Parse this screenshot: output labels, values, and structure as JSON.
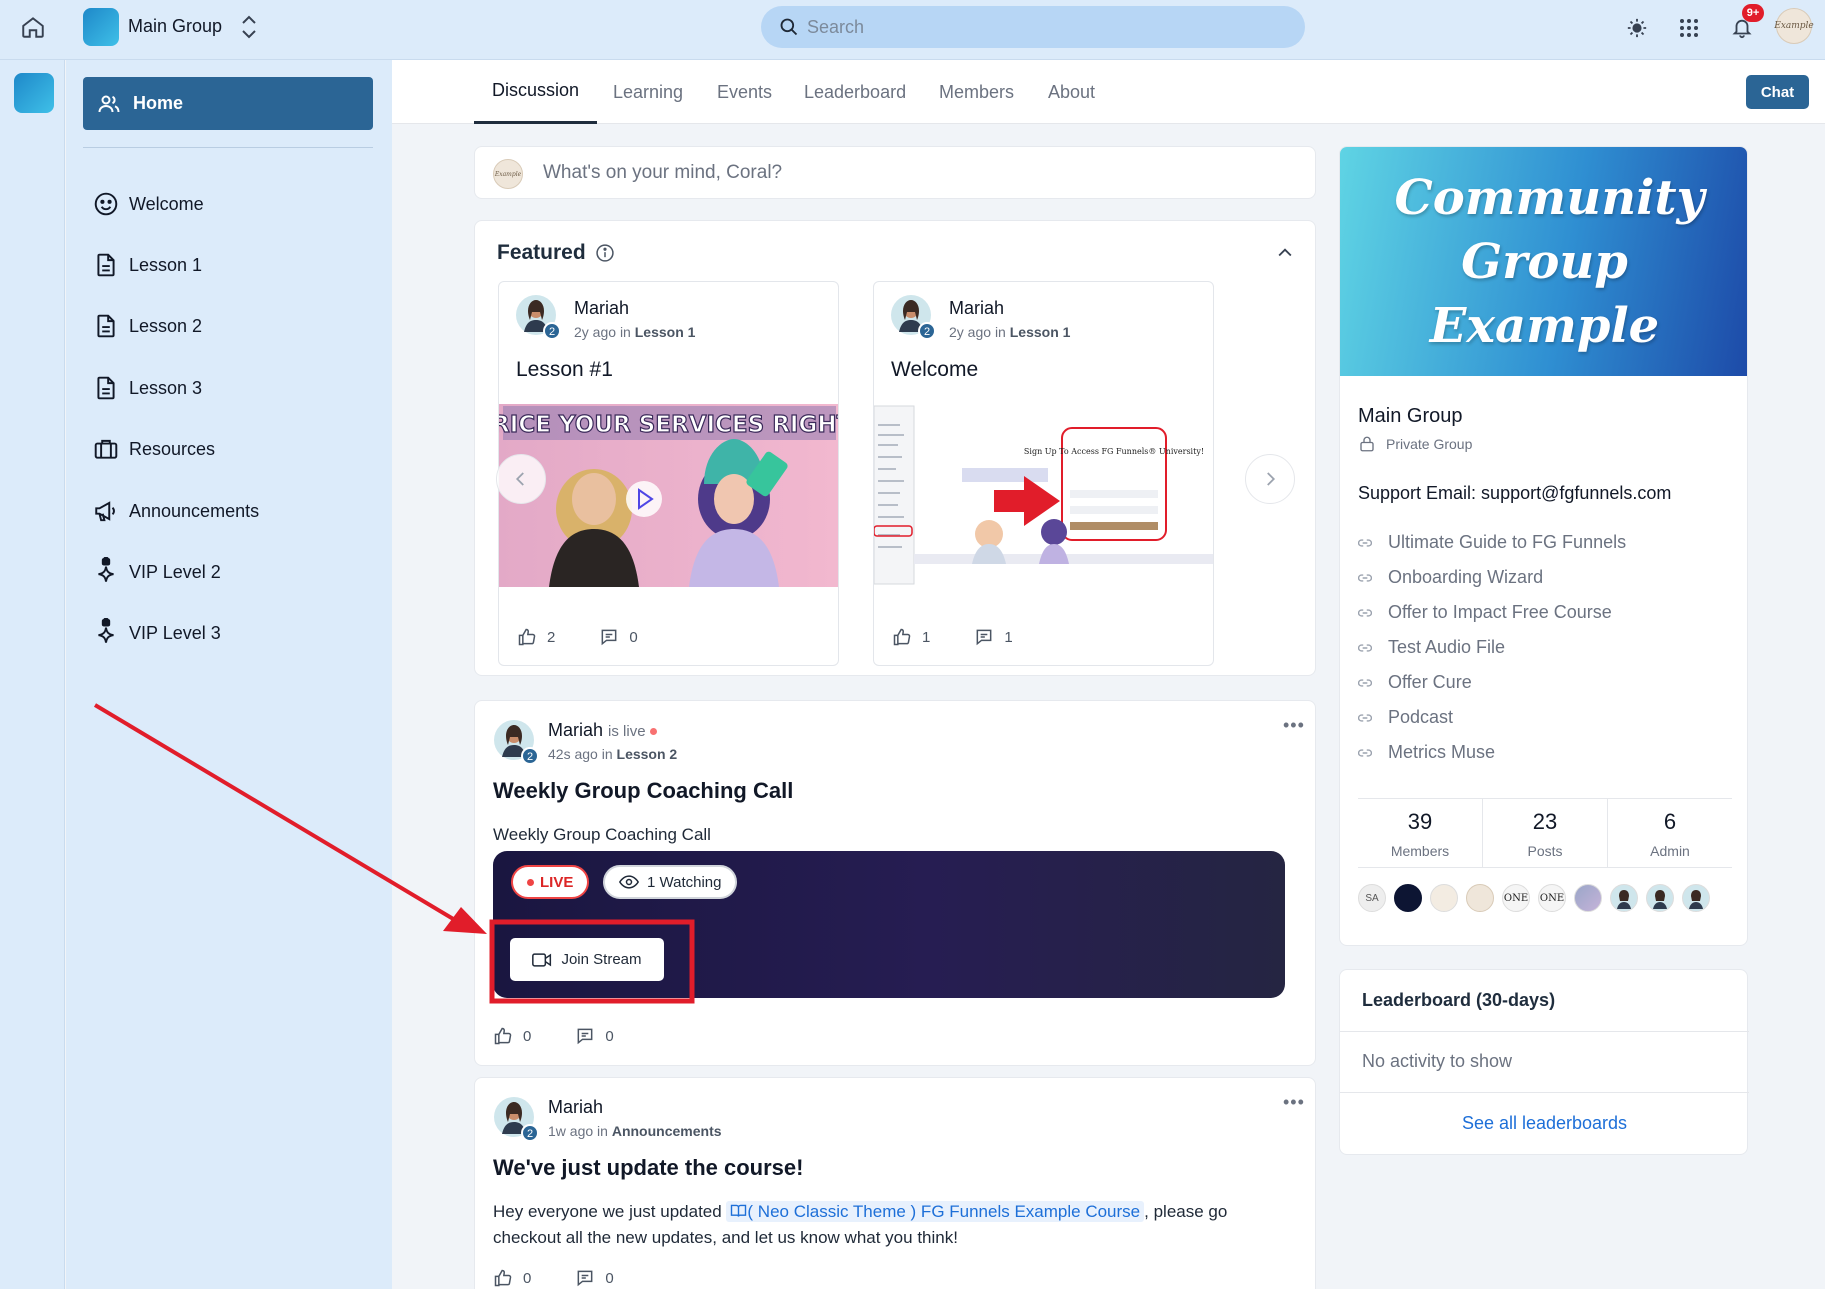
{
  "topbar": {
    "group_name": "Main Group",
    "search_placeholder": "Search",
    "notification_count": "9+",
    "avatar_text": "Example"
  },
  "sidebar": {
    "home_label": "Home",
    "items": [
      {
        "label": "Welcome",
        "icon": "smile-icon"
      },
      {
        "label": "Lesson 1",
        "icon": "document-icon"
      },
      {
        "label": "Lesson 2",
        "icon": "document-icon"
      },
      {
        "label": "Lesson 3",
        "icon": "document-icon"
      },
      {
        "label": "Resources",
        "icon": "briefcase-icon"
      },
      {
        "label": "Announcements",
        "icon": "megaphone-icon"
      },
      {
        "label": "VIP Level 2",
        "icon": "sparkle-lock-icon"
      },
      {
        "label": "VIP Level 3",
        "icon": "sparkle-lock-icon"
      }
    ]
  },
  "tabs": [
    {
      "label": "Discussion",
      "active": true
    },
    {
      "label": "Learning"
    },
    {
      "label": "Events"
    },
    {
      "label": "Leaderboard"
    },
    {
      "label": "Members"
    },
    {
      "label": "About"
    }
  ],
  "chat_label": "Chat",
  "composer": {
    "placeholder": "What's on your mind, Coral?",
    "avatar_text": "Example"
  },
  "featured": {
    "title": "Featured",
    "cards": [
      {
        "author": "Mariah",
        "badge": "2",
        "time": "2y ago",
        "in_word": "in",
        "space": "Lesson 1",
        "title": "Lesson #1",
        "thumb_text": "PRICE YOUR SERVICES RIGHT!",
        "likes": "2",
        "comments": "0"
      },
      {
        "author": "Mariah",
        "badge": "2",
        "time": "2y ago",
        "in_word": "in",
        "space": "Lesson 1",
        "title": "Welcome",
        "thumb_text": "Sign Up To Access FG Funnels® University!",
        "likes": "1",
        "comments": "1"
      }
    ]
  },
  "posts": [
    {
      "author": "Mariah",
      "badge": "2",
      "status": "is live",
      "time": "42s ago",
      "in_word": "in",
      "space": "Lesson 2",
      "title": "Weekly Group Coaching Call",
      "body": "Weekly Group Coaching Call",
      "live_label": "LIVE",
      "watching_label": "1 Watching",
      "join_label": "Join Stream",
      "likes": "0",
      "comments": "0"
    },
    {
      "author": "Mariah",
      "badge": "2",
      "time": "1w ago",
      "in_word": "in",
      "space": "Announcements",
      "title": "We've just update the course!",
      "body_before": "Hey everyone we just updated ",
      "body_link": "( Neo Classic Theme ) FG Funnels Example Course",
      "body_after": ", please go checkout all the new updates, and let us know what you think!",
      "likes": "0",
      "comments": "0"
    }
  ],
  "about": {
    "banner_text": "Community Group Example",
    "group_name": "Main Group",
    "privacy": "Private Group",
    "support": "Support Email: support@fgfunnels.com",
    "links": [
      "Ultimate Guide to FG Funnels",
      "Onboarding Wizard",
      "Offer to Impact Free Course",
      "Test Audio File",
      "Offer Cure",
      "Podcast",
      "Metrics Muse"
    ],
    "stats": [
      {
        "num": "39",
        "label": "Members"
      },
      {
        "num": "23",
        "label": "Posts"
      },
      {
        "num": "6",
        "label": "Admin"
      }
    ],
    "member_initials": [
      "SA",
      "",
      "",
      "",
      "ONE",
      "ONE",
      "",
      "",
      "",
      ""
    ]
  },
  "leaderboard": {
    "title": "Leaderboard (30-days)",
    "empty": "No activity to show",
    "see_all": "See all leaderboards"
  },
  "colors": {
    "primary": "#2b6595",
    "sidebar_bg": "#dcebfa",
    "link": "#1d6fd8",
    "live": "#ef4444",
    "annotation": "#e11d2a"
  }
}
